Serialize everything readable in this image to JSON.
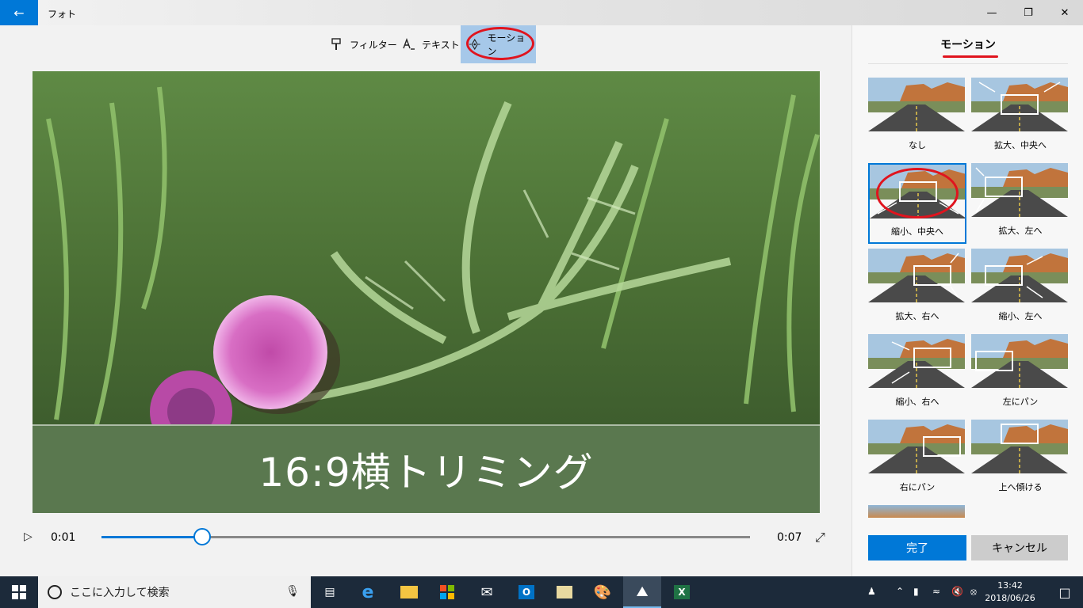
{
  "titlebar": {
    "back_icon": "back-arrow-icon",
    "app_title": "フォト"
  },
  "toolbar": {
    "filter_label": "フィルター",
    "text_label": "テキスト",
    "motion_label": "モーション"
  },
  "preview": {
    "caption": "16:9横トリミング"
  },
  "playback": {
    "current_time": "0:01",
    "total_time": "0:07",
    "progress": 0.155
  },
  "panel": {
    "title": "モーション",
    "motions": [
      {
        "label": "なし"
      },
      {
        "label": "拡大、中央へ"
      },
      {
        "label": "縮小、中央へ"
      },
      {
        "label": "拡大、左へ"
      },
      {
        "label": "拡大、右へ"
      },
      {
        "label": "縮小、左へ"
      },
      {
        "label": "縮小、右へ"
      },
      {
        "label": "左にパン"
      },
      {
        "label": "右にパン"
      },
      {
        "label": "上へ傾ける"
      }
    ],
    "selected_motion": "縮小、中央へ",
    "done_label": "完了",
    "cancel_label": "キャンセル"
  },
  "taskbar": {
    "search_placeholder": "ここに入力して検索",
    "time": "13:42",
    "date": "2018/06/26"
  },
  "colors": {
    "accent": "#0078d7",
    "annotation_red": "#e0141e",
    "taskbar": "#1c2a3a"
  }
}
